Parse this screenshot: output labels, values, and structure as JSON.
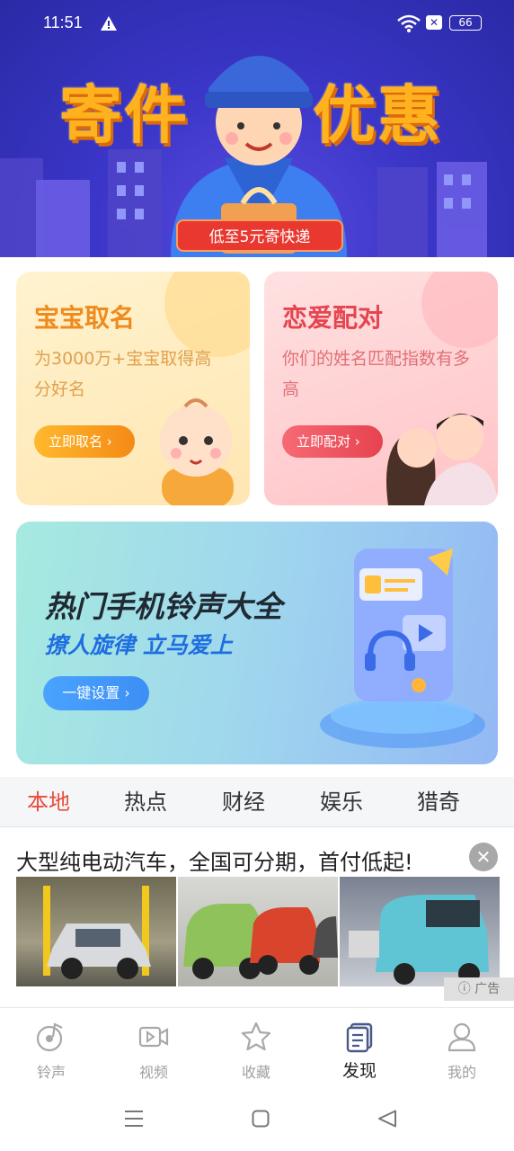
{
  "status_bar": {
    "time": "11:51",
    "battery": "66"
  },
  "banner": {
    "title_left": "寄件",
    "title_right": "优惠",
    "label": "低至5元寄快递"
  },
  "cards": [
    {
      "title": "宝宝取名",
      "desc": "为3000万+宝宝取得高分好名",
      "button": "立即取名 ›"
    },
    {
      "title": "恋爱配对",
      "desc": "你们的姓名匹配指数有多高",
      "button": "立即配对 ›"
    }
  ],
  "ringtone_banner": {
    "title": "热门手机铃声大全",
    "subtitle": "撩人旋律 立马爱上",
    "button": "一键设置 ›"
  },
  "tabs": [
    {
      "label": "本地",
      "active": true
    },
    {
      "label": "热点",
      "active": false
    },
    {
      "label": "财经",
      "active": false
    },
    {
      "label": "娱乐",
      "active": false
    },
    {
      "label": "猎奇",
      "active": false
    }
  ],
  "ad": {
    "title": "大型纯电动汽车，全国可分期，首付低起!",
    "tag": "广告"
  },
  "bottom_nav": [
    {
      "label": "铃声",
      "icon": "music-note-icon",
      "active": false
    },
    {
      "label": "视频",
      "icon": "video-icon",
      "active": false
    },
    {
      "label": "收藏",
      "icon": "star-icon",
      "active": false
    },
    {
      "label": "发现",
      "icon": "discover-icon",
      "active": true
    },
    {
      "label": "我的",
      "icon": "profile-icon",
      "active": false
    }
  ],
  "colors": {
    "accent_red": "#e84c3d",
    "banner_blue": "#2a2aa6",
    "banner_gold": "#ffb21e"
  }
}
